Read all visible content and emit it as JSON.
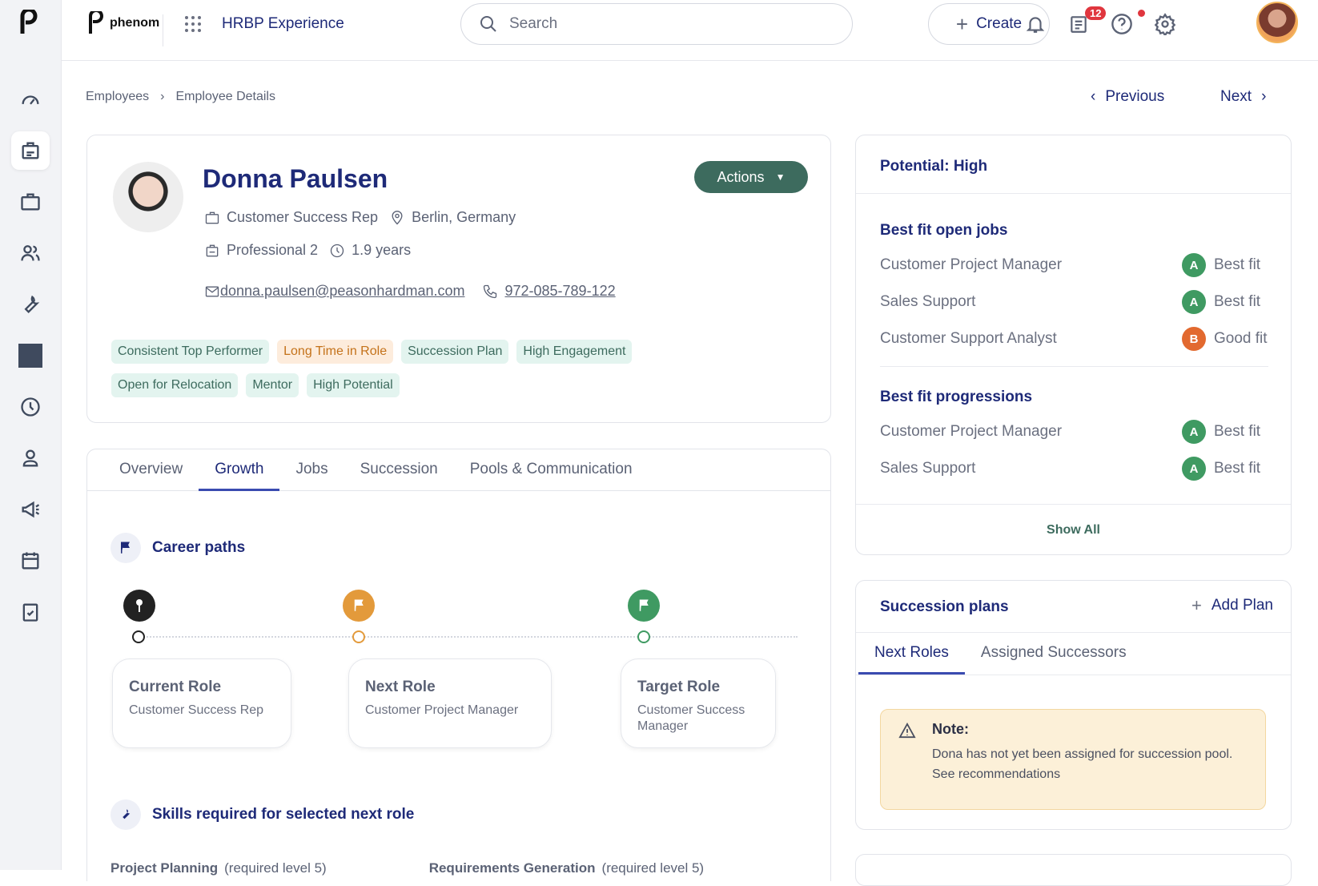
{
  "app": {
    "brand": "phenom",
    "title": "HRBP Experience"
  },
  "search": {
    "placeholder": "Search"
  },
  "header": {
    "create_label": "Create",
    "notification_count": "12"
  },
  "rail_icons": [
    "dashboard-icon",
    "id-badge-icon",
    "briefcase-icon",
    "people-icon",
    "tools-icon",
    "square-icon",
    "clock-icon",
    "person-icon",
    "megaphone-icon",
    "calendar-icon",
    "checklist-icon"
  ],
  "breadcrumb": {
    "items": [
      "Employees",
      "Employee Details"
    ]
  },
  "pager": {
    "previous": "Previous",
    "next": "Next"
  },
  "employee": {
    "name": "Donna Paulsen",
    "title": "Customer Success Rep",
    "location": "Berlin, Germany",
    "level": "Professional 2",
    "tenure": "1.9 years",
    "email": "donna.paulsen@peasonhardman.com",
    "phone": "972-085-789-122",
    "actions_label": "Actions",
    "tags": [
      {
        "label": "Consistent Top Performer",
        "color": "#3d6b5e"
      },
      {
        "label": "Long Time in Role",
        "color": "#c4721a"
      },
      {
        "label": "Succession Plan",
        "color": "#3d6b5e"
      },
      {
        "label": "High Engagement",
        "color": "#3d6b5e"
      },
      {
        "label": "Open for Relocation",
        "color": "#3d6b5e"
      },
      {
        "label": "Mentor",
        "color": "#3d6b5e"
      },
      {
        "label": "High Potential",
        "color": "#3d6b5e"
      }
    ]
  },
  "tabs": [
    "Overview",
    "Growth",
    "Jobs",
    "Succession",
    "Pools & Communication"
  ],
  "active_tab": "Growth",
  "growth": {
    "career_paths_title": "Career paths",
    "roles": [
      {
        "label": "Current Role",
        "name": "Customer Success Rep",
        "color": "#222222"
      },
      {
        "label": "Next Role",
        "name": "Customer Project Manager",
        "color": "#e39a3b"
      },
      {
        "label": "Target Role",
        "name": "Customer Success Manager",
        "color": "#3f9a62"
      }
    ],
    "skills_title": "Skills required for selected next role",
    "skills_peek": [
      "Project Planning",
      "(required level 5)",
      "Requirements Generation",
      "(required level 5)"
    ]
  },
  "potential": {
    "title": "Potential: High",
    "open_jobs_title": "Best fit open jobs",
    "open_jobs": [
      {
        "title": "Customer Project Manager",
        "grade": "A",
        "fit": "Best fit",
        "color": "#3f9a62"
      },
      {
        "title": "Sales Support",
        "grade": "A",
        "fit": "Best fit",
        "color": "#3f9a62"
      },
      {
        "title": "Customer Support Analyst",
        "grade": "B",
        "fit": "Good fit",
        "color": "#e2692f"
      }
    ],
    "progressions_title": "Best fit progressions",
    "progressions": [
      {
        "title": "Customer Project Manager",
        "grade": "A",
        "fit": "Best fit",
        "color": "#3f9a62"
      },
      {
        "title": "Sales Support",
        "grade": "A",
        "fit": "Best fit",
        "color": "#3f9a62"
      }
    ],
    "show_all": "Show All"
  },
  "succession": {
    "title": "Succession plans",
    "add_plan": "Add Plan",
    "tabs": [
      "Next Roles",
      "Assigned Successors"
    ],
    "note_title": "Note:",
    "note_body": "Dona has not yet been assigned for succession pool.",
    "note_link": "See recommendations"
  }
}
